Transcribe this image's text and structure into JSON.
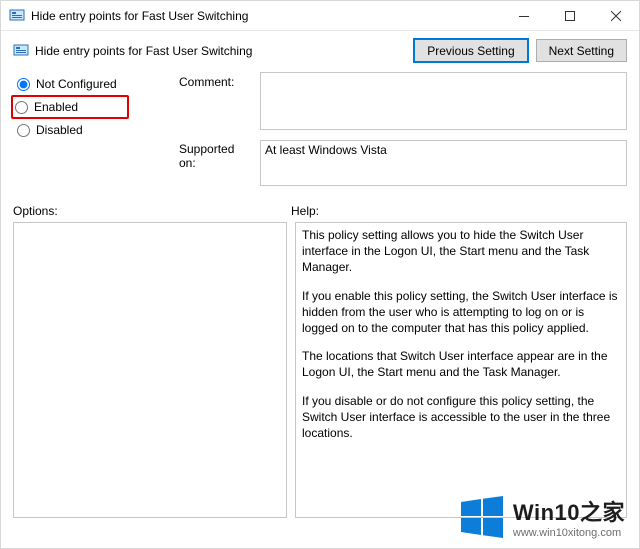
{
  "window": {
    "title": "Hide entry points for Fast User Switching"
  },
  "header": {
    "heading": "Hide entry points for Fast User Switching",
    "prev_button": "Previous Setting",
    "next_button": "Next Setting"
  },
  "radios": {
    "not_configured": "Not Configured",
    "enabled": "Enabled",
    "disabled": "Disabled",
    "selected": "not_configured"
  },
  "labels": {
    "comment": "Comment:",
    "supported_on": "Supported on:",
    "options": "Options:",
    "help": "Help:"
  },
  "fields": {
    "comment_value": "",
    "supported_on_value": "At least Windows Vista"
  },
  "help_paragraphs": [
    "This policy setting allows you to hide the Switch User interface in the Logon UI, the Start menu and the Task Manager.",
    "If you enable this policy setting, the Switch User interface is hidden from the user who is attempting to log on or is logged on to the computer that has this policy applied.",
    "The locations that Switch User interface appear are in the Logon UI, the Start menu and the Task Manager.",
    "If you disable or do not configure this policy setting, the Switch User interface is accessible to the user in the three locations."
  ],
  "watermark": {
    "title": "Win10之家",
    "url": "www.win10xitong.com"
  }
}
